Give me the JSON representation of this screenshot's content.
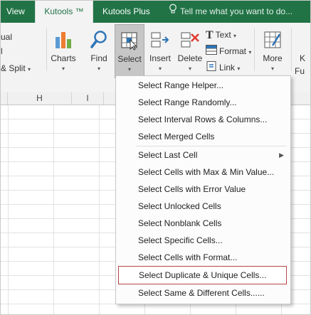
{
  "tabs": {
    "view": "View",
    "kutools": "Kutools ™",
    "kutools_plus": "Kutools Plus",
    "tell_me": "Tell me what you want to do..."
  },
  "ribbon": {
    "partial_top": "ual",
    "partial_mid": "l",
    "split": "& Split",
    "charts": "Charts",
    "find": "Find",
    "select": "Select",
    "insert": "Insert",
    "delete": "Delete",
    "text": "Text",
    "format": "Format",
    "link": "Link",
    "more": "More",
    "partial_right_top": "K",
    "partial_right_bottom": "Fu"
  },
  "columns": [
    "H",
    "I"
  ],
  "select_menu": {
    "items": [
      {
        "label": "Select Range Helper..."
      },
      {
        "label": "Select Range Randomly..."
      },
      {
        "label": "Select Interval Rows & Columns..."
      },
      {
        "label": "Select Merged Cells"
      },
      {
        "label": "Select Last Cell",
        "submenu": true
      },
      {
        "label": "Select Cells with Max & Min Value..."
      },
      {
        "label": "Select Cells with Error Value"
      },
      {
        "label": "Select Unlocked Cells"
      },
      {
        "label": "Select Nonblank Cells"
      },
      {
        "label": "Select Specific Cells..."
      },
      {
        "label": "Select Cells with Format..."
      },
      {
        "label": "Select Duplicate & Unique Cells...",
        "highlighted": true
      },
      {
        "label": "Select Same & Different Cells......"
      }
    ]
  },
  "colors": {
    "tab_green": "#217346",
    "highlight_border": "#b64747"
  }
}
